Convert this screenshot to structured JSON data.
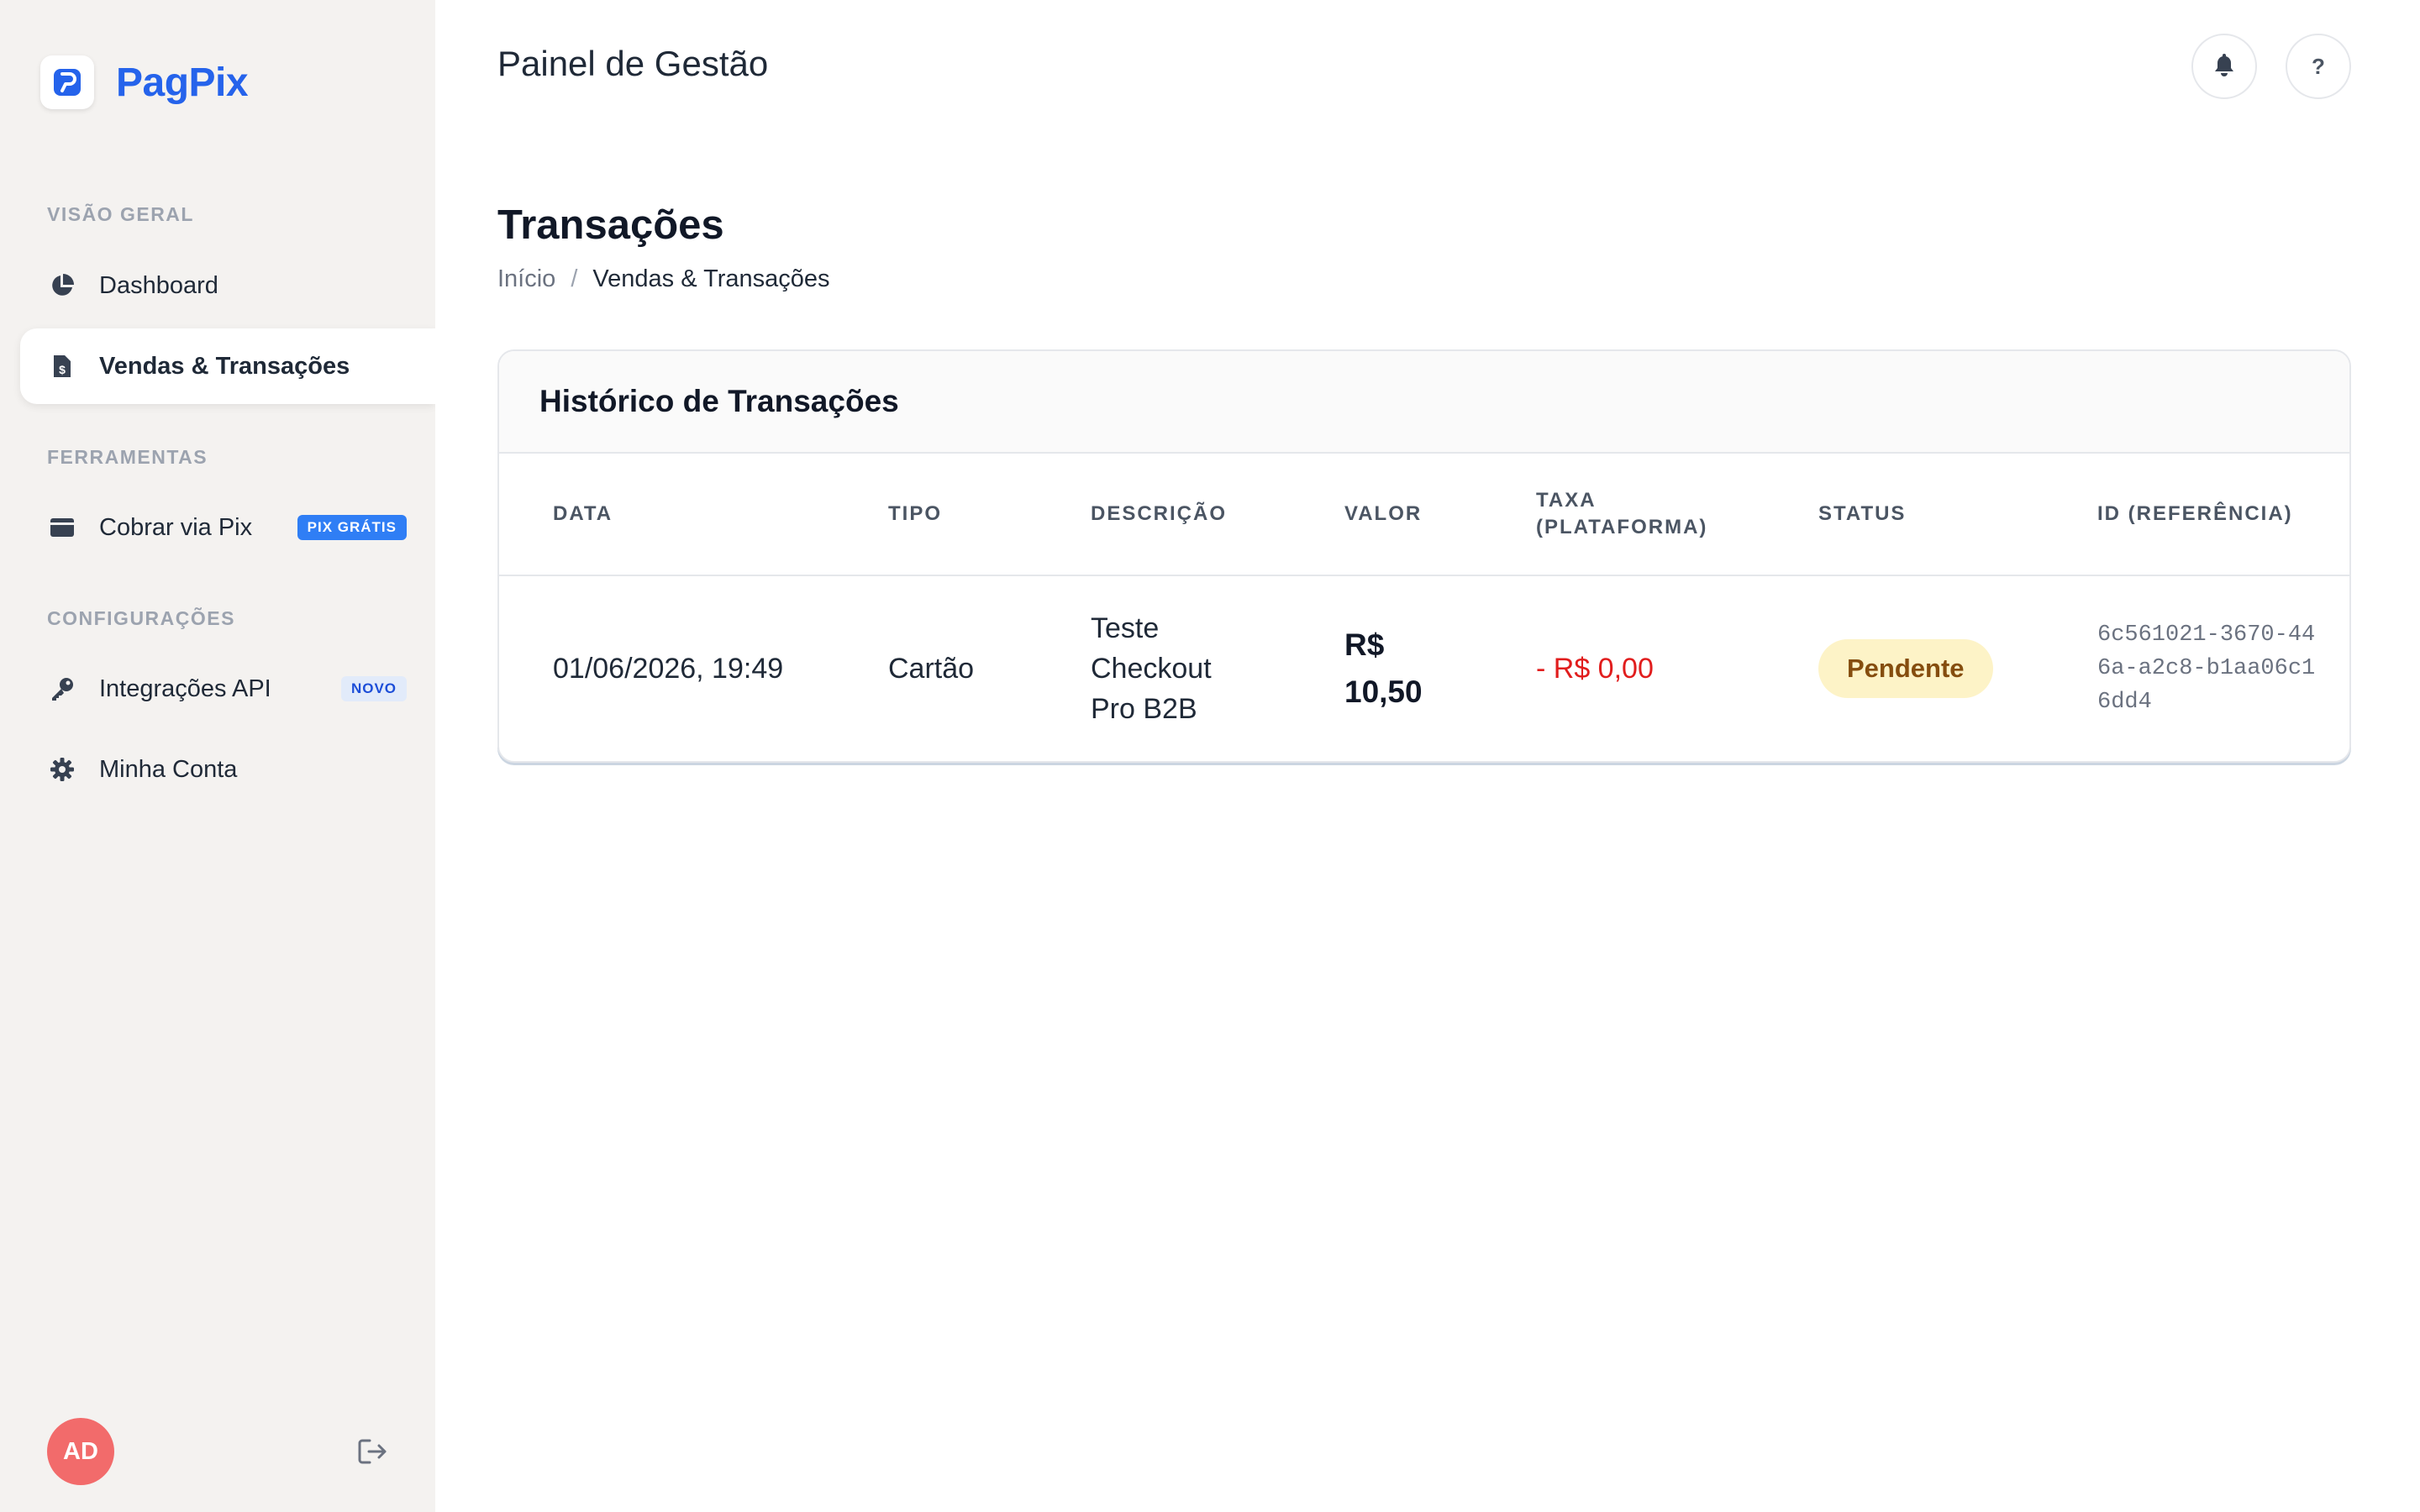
{
  "brand": {
    "name": "PagPix"
  },
  "sidebar": {
    "sections": [
      {
        "label": "VISÃO GERAL"
      },
      {
        "label": "FERRAMENTAS"
      },
      {
        "label": "CONFIGURAÇÕES"
      }
    ],
    "items": [
      {
        "label": "Dashboard",
        "icon": "pie-chart-icon",
        "active": false
      },
      {
        "label": "Vendas & Transações",
        "icon": "receipt-icon",
        "active": true
      },
      {
        "label": "Cobrar via Pix",
        "icon": "wallet-icon",
        "badge": "PIX GRÁTIS"
      },
      {
        "label": "Integrações API",
        "icon": "key-icon",
        "badge": "NOVO"
      },
      {
        "label": "Minha Conta",
        "icon": "gear-icon"
      }
    ],
    "user": {
      "initials": "AD"
    }
  },
  "header": {
    "title": "Painel de Gestão"
  },
  "page": {
    "title": "Transações",
    "breadcrumb": {
      "home": "Início",
      "separator": "/",
      "current": "Vendas & Transações"
    }
  },
  "table": {
    "card_title": "Histórico de Transações",
    "columns": [
      "DATA",
      "TIPO",
      "DESCRIÇÃO",
      "VALOR",
      "TAXA (PLATAFORMA)",
      "STATUS",
      "ID (REFERÊNCIA)"
    ],
    "rows": [
      {
        "data": "01/06/2026, 19:49",
        "tipo": "Cartão",
        "descricao": "Teste Checkout Pro B2B",
        "valor": "R$ 10,50",
        "taxa": "- R$ 0,00",
        "status": "Pendente",
        "id": "6c561021-3670-446a-a2c8-b1aa06c16dd4"
      }
    ]
  },
  "colors": {
    "brand": "#2563eb",
    "sidebar_bg": "#f4f2f0",
    "badge_blue": "#2f7ef5",
    "fee_red": "#e11d1d",
    "status_pending_bg": "#fdf3c7",
    "status_pending_text": "#854d0e",
    "avatar": "#f26b6b"
  }
}
